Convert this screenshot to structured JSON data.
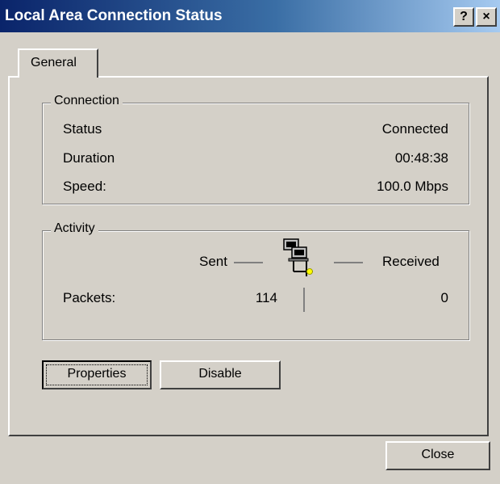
{
  "window": {
    "title": "Local Area Connection Status",
    "help_label": "?",
    "close_label": "×"
  },
  "tabs": [
    {
      "label": "General"
    }
  ],
  "connection": {
    "legend": "Connection",
    "rows": [
      {
        "label": "Status",
        "value": "Connected"
      },
      {
        "label": "Duration",
        "value": "00:48:38"
      },
      {
        "label": "Speed:",
        "value": "100.0 Mbps"
      }
    ]
  },
  "activity": {
    "legend": "Activity",
    "sent_label": "Sent",
    "received_label": "Received",
    "packets_label": "Packets:",
    "packets_sent": "114",
    "packets_received": "0"
  },
  "buttons": {
    "properties": "Properties",
    "disable": "Disable",
    "close": "Close"
  }
}
